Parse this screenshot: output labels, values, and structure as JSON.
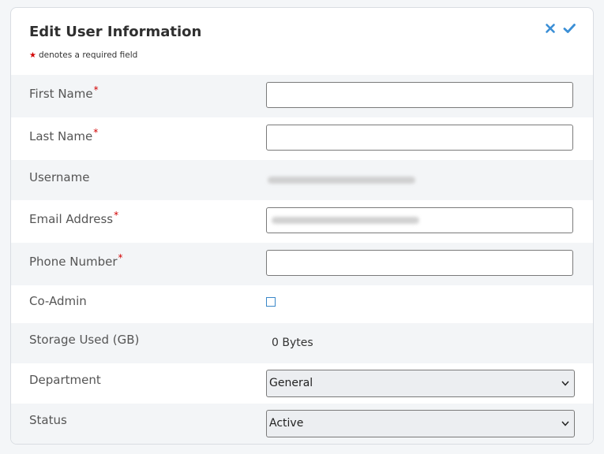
{
  "form": {
    "title": "Edit User Information",
    "required_note": "denotes a required field",
    "required_marker": "*"
  },
  "actions": {
    "cancel_icon": "close-icon",
    "save_icon": "checkmark-icon",
    "accent_color": "#3b8fd6"
  },
  "fields": {
    "first_name": {
      "label": "First Name",
      "value": ""
    },
    "last_name": {
      "label": "Last Name",
      "value": ""
    },
    "username": {
      "label": "Username"
    },
    "email": {
      "label": "Email Address"
    },
    "phone": {
      "label": "Phone Number",
      "value": ""
    },
    "co_admin": {
      "label": "Co-Admin",
      "checked": false
    },
    "storage": {
      "label": "Storage Used (GB)",
      "value": "0 Bytes"
    },
    "department": {
      "label": "Department",
      "selected": "General"
    },
    "status": {
      "label": "Status",
      "selected": "Active"
    }
  }
}
